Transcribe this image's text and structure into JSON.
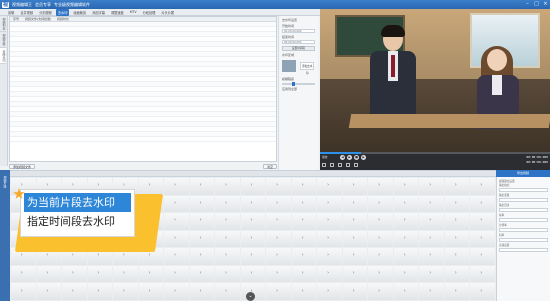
{
  "titlebar": {
    "logo": "视",
    "text": "视频编辑王",
    "subtitle": "会员专享",
    "extra": "专业级视频编辑软件"
  },
  "menu": {
    "items": [
      "剪辑",
      "合并视频",
      "分割视频",
      "去水印",
      "画面裁剪",
      "添加字幕",
      "调整速度",
      "MTV",
      "分段处理",
      "片头片尾"
    ],
    "active_index": 3
  },
  "vtabs": [
    "视频列表",
    "视频文件",
    "去除水印"
  ],
  "filelist": {
    "columns": [
      "序号",
      "视频文件(支持批量)",
      "视频时长"
    ],
    "rows": 24
  },
  "filelist_buttons": [
    "添加视频文件",
    "清空"
  ],
  "settings": {
    "title": "去水印设置",
    "start_label": "开始时间",
    "start_value": "00:00:00.000",
    "end_label": "结束时间",
    "end_value": "00:00:00.000",
    "set_button": "设置时间段",
    "wm_label": "水印区域",
    "add_wm": "添加去水印",
    "blur_label": "模糊程度",
    "check_label": "应用到全部"
  },
  "player": {
    "progress": 0.18,
    "time_current": "00:00:00.000",
    "time_total": "00:00:00.000",
    "label": "播放"
  },
  "export_button": "导出视频",
  "timeline": {
    "side_label": "视频片段",
    "rows": 7,
    "cols": 19
  },
  "right_panel": {
    "lines": [
      "视频输出设置",
      "输出格式",
      "输出质量",
      "输出目录",
      "帧率",
      "分辨率",
      "码率",
      "音频设置"
    ]
  },
  "callout": {
    "option1": "为当前片段去水印",
    "option2": "指定时间段去水印",
    "selected": 0
  },
  "colors": {
    "accent": "#2e74c6",
    "highlight": "#fbc02d",
    "title_bar": "#2a67b3"
  }
}
